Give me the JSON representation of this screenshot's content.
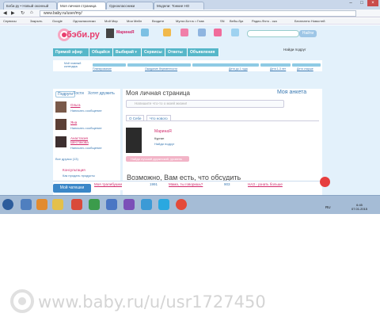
{
  "browser": {
    "tabs": [
      "Бэби.ру • Новый оконный",
      "Моя личная страница",
      "Одноклассники",
      "Модели: Тонкие НО"
    ],
    "address": "www.baby.ru/user/my/",
    "bookmarks": [
      "Сервисы",
      "Закрыть",
      "Google",
      "Одноклассники",
      "Мой Мир",
      "Мои Мейл",
      "Входите",
      "Мульт-Бот.ru • Глав",
      "SN",
      "Вебы-бук",
      "Радио-Фото - ска",
      "Бесплатно Новостей"
    ]
  },
  "header": {
    "logo": "бэби.ру",
    "user_name": "МаринаЯ",
    "search_button": "Найти",
    "find_friends": "Найди подруг"
  },
  "nav": [
    "Прямой эфир",
    "Общайся",
    "Выбирай ▾",
    "Сервисы",
    "Ответы",
    "Объявления"
  ],
  "progress": {
    "labels": [
      "Планирование",
      "Ожидание беременности",
      "Дети до 1 года",
      "Дети 1-3 лет",
      "Дети старше"
    ],
    "label_top": "Мой главный календарь"
  },
  "left": {
    "tabs": [
      "Подруги",
      "Гости",
      "Хотят дружить"
    ],
    "friends": [
      {
        "name": "Ольга",
        "action": "Написать сообщение"
      },
      {
        "name": "Яна",
        "action": "Написать сообщение"
      },
      {
        "name": "Анастасия Шестакова",
        "action": "Написать сообщение"
      }
    ],
    "all_friends": "Все друзья (13)",
    "consultation": "Консультация",
    "how_sell": "Как продать продукты"
  },
  "main": {
    "title": "Моя личная страница",
    "my_profile": "Моя анкета",
    "status_placeholder": "Напишите что-то о моей жизни!",
    "tabs": [
      "О Себе",
      "Что нового"
    ],
    "profile_name": "МаринаЯ",
    "city": "Курган",
    "more": "Найди подруг",
    "add_button": "Найди лучший дружеский, уровень",
    "maybe": "Возможно, Вам есть, что обсудить"
  },
  "bottom": {
    "chat": "Мой чатешки",
    "items": [
      "Моя тралибушки",
      "1991",
      "Мама, ты говоришь?",
      "903",
      "НАЗ - узнать больше"
    ]
  },
  "taskbar": {
    "lang": "RU",
    "time": "6:45",
    "date": "07.01.2015"
  },
  "watermark": "www.baby.ru/u/usr1727450",
  "colors": {
    "accent": "#56b7c9",
    "brand": "#e83e6e",
    "link": "#3a79b2"
  }
}
